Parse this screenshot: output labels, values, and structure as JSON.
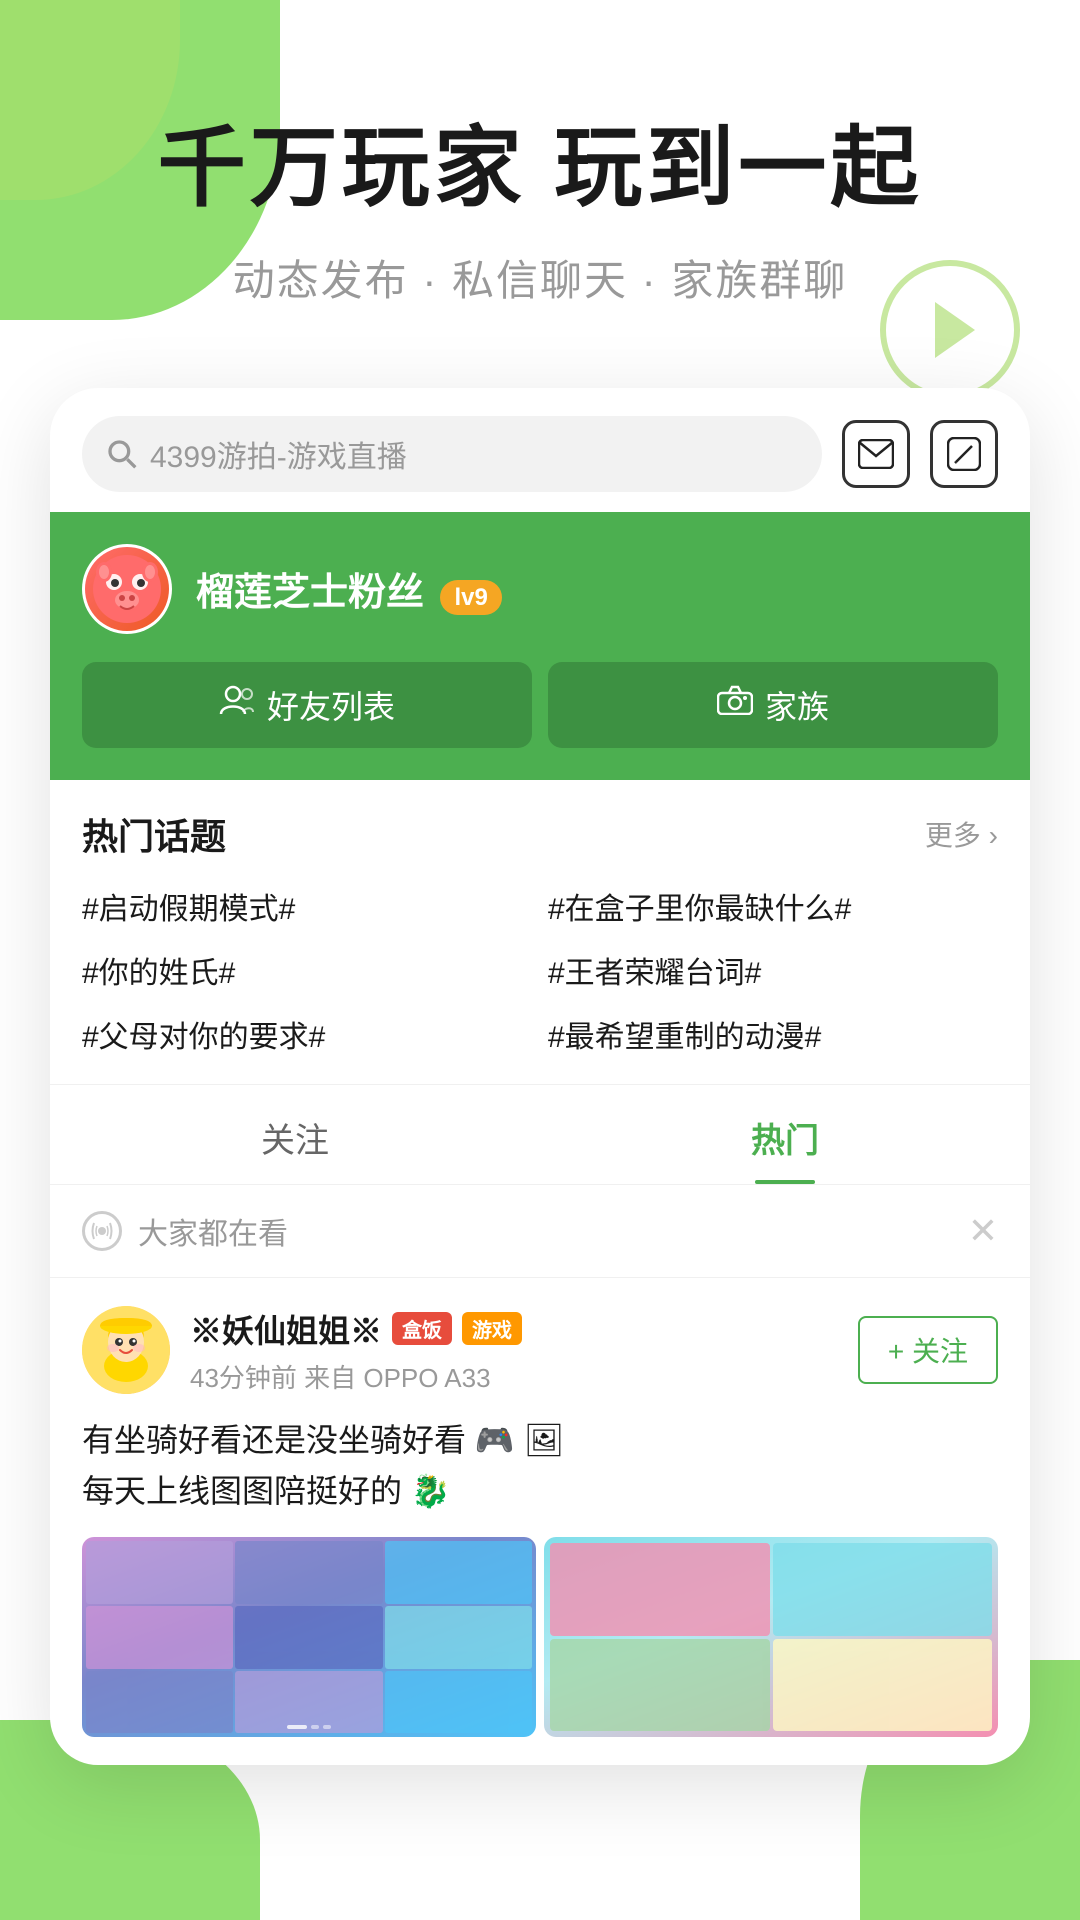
{
  "hero": {
    "title": "千万玩家 玩到一起",
    "subtitle": "动态发布 · 私信聊天 · 家族群聊"
  },
  "search": {
    "placeholder": "4399游拍-游戏直播",
    "icon_name": "search-icon"
  },
  "icons": {
    "mail": "✉",
    "edit": "✏",
    "more": "更多 ›",
    "close": "✕"
  },
  "user": {
    "name": "榴莲芝士粉丝",
    "level": "lv9",
    "btn_friends": "好友列表",
    "btn_family": "家族"
  },
  "hot_topics": {
    "title": "热门话题",
    "more": "更多 ›",
    "items": [
      "#启动假期模式#",
      "#在盒子里你最缺什么#",
      "#你的姓氏#",
      "#王者荣耀台词#",
      "#父母对你的要求#",
      "#最希望重制的动漫#"
    ]
  },
  "tabs": [
    {
      "label": "关注",
      "active": false
    },
    {
      "label": "热门",
      "active": true
    }
  ],
  "watching_banner": {
    "text": "大家都在看"
  },
  "post": {
    "username": "※妖仙姐姐※",
    "badges": [
      "盒饭",
      "游戏"
    ],
    "meta": "43分钟前  来自 OPPO A33",
    "follow_label": "+ 关注",
    "content_line1": "有坐骑好看还是没坐骑好看 🎮 🖼",
    "content_line2": "每天上线图图陪挺好的 🐉"
  }
}
